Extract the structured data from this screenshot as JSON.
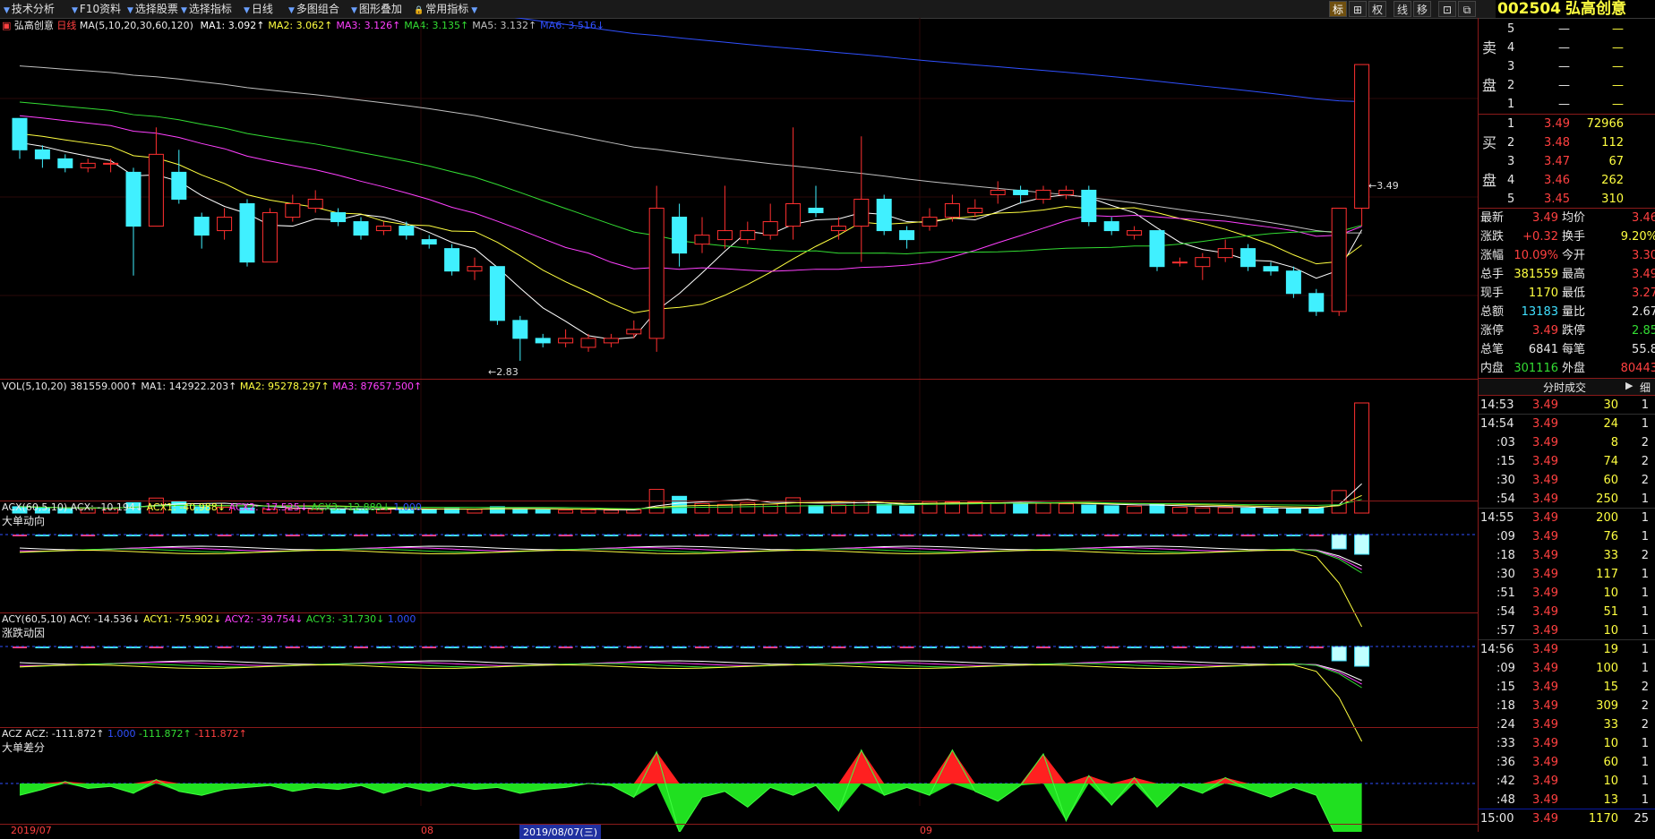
{
  "toolbar": {
    "items": [
      "技术分析",
      "F10资料",
      "选择股票",
      "选择指标",
      "日线",
      "多图组合",
      "图形叠加",
      "常用指标"
    ],
    "icons": [
      "标",
      "⊞",
      "权",
      "线",
      "移",
      "⊡",
      "⧉"
    ]
  },
  "stock": {
    "code": "002504",
    "name": "弘高创意"
  },
  "chart": {
    "title": "弘高创意",
    "period": "日线",
    "ma_label": "MA(5,10,20,30,60,120)",
    "ma": [
      {
        "name": "MA1:",
        "value": "3.092↑",
        "color": "#ffffff"
      },
      {
        "name": "MA2:",
        "value": "3.062↑",
        "color": "#ffff40"
      },
      {
        "name": "MA3:",
        "value": "3.126↑",
        "color": "#ff40ff"
      },
      {
        "name": "MA4:",
        "value": "3.135↑",
        "color": "#33dd33"
      },
      {
        "name": "MA5:",
        "value": "3.132↑",
        "color": "#c0c0c0"
      },
      {
        "name": "MA6:",
        "value": "3.516↓",
        "color": "#3050ff"
      }
    ],
    "high_mark": "3.49",
    "low_mark": "2.83",
    "vol": {
      "label": "VOL(5,10,20)",
      "value": "381559.000↑",
      "ma1": "MA1: 142922.203↑",
      "ma2": "MA2: 95278.297↑",
      "ma3": "MA3: 87657.500↑"
    },
    "acx": {
      "label": "ACX(60,5,10)",
      "acx": "ACX: -10.194↓",
      "acx1": "ACX1: -40.988↓",
      "acx2": "ACX2: -17.525↓",
      "acx3": "ACX3: -12.889↓",
      "c": "1.000",
      "sub": "大单动向"
    },
    "acy": {
      "label": "ACY(60,5,10)",
      "acy": "ACY: -14.536↓",
      "acy1": "ACY1: -75.902↓",
      "acy2": "ACY2: -39.754↓",
      "acy3": "ACY3: -31.730↓",
      "c": "1.000",
      "sub": "涨跌动因"
    },
    "acz": {
      "label": "ACZ",
      "acz": "ACZ: -111.872↑",
      "c": "1.000",
      "v2": "-111.872↑",
      "v3": "-111.872↑",
      "sub": "大单差分"
    },
    "dates": [
      "2019/07",
      "08",
      "2019/08/07(三)",
      "09"
    ]
  },
  "chart_data": {
    "type": "candlestick",
    "candles": [
      {
        "o": 3.37,
        "c": 3.3,
        "h": 3.37,
        "l": 3.28
      },
      {
        "o": 3.3,
        "c": 3.28,
        "h": 3.31,
        "l": 3.26
      },
      {
        "o": 3.28,
        "c": 3.26,
        "h": 3.29,
        "l": 3.25
      },
      {
        "o": 3.26,
        "c": 3.27,
        "h": 3.28,
        "l": 3.25
      },
      {
        "o": 3.27,
        "c": 3.27,
        "h": 3.28,
        "l": 3.25
      },
      {
        "o": 3.25,
        "c": 3.13,
        "h": 3.26,
        "l": 3.02
      },
      {
        "o": 3.13,
        "c": 3.29,
        "h": 3.35,
        "l": 3.13
      },
      {
        "o": 3.25,
        "c": 3.19,
        "h": 3.3,
        "l": 3.18
      },
      {
        "o": 3.15,
        "c": 3.11,
        "h": 3.16,
        "l": 3.08
      },
      {
        "o": 3.12,
        "c": 3.15,
        "h": 3.17,
        "l": 3.1
      },
      {
        "o": 3.18,
        "c": 3.05,
        "h": 3.19,
        "l": 3.04
      },
      {
        "o": 3.05,
        "c": 3.16,
        "h": 3.17,
        "l": 3.05
      },
      {
        "o": 3.15,
        "c": 3.18,
        "h": 3.2,
        "l": 3.14
      },
      {
        "o": 3.17,
        "c": 3.19,
        "h": 3.21,
        "l": 3.16
      },
      {
        "o": 3.16,
        "c": 3.14,
        "h": 3.17,
        "l": 3.13
      },
      {
        "o": 3.14,
        "c": 3.11,
        "h": 3.15,
        "l": 3.1
      },
      {
        "o": 3.12,
        "c": 3.13,
        "h": 3.14,
        "l": 3.11
      },
      {
        "o": 3.13,
        "c": 3.11,
        "h": 3.14,
        "l": 3.1
      },
      {
        "o": 3.1,
        "c": 3.09,
        "h": 3.11,
        "l": 3.08
      },
      {
        "o": 3.08,
        "c": 3.03,
        "h": 3.09,
        "l": 3.02
      },
      {
        "o": 3.03,
        "c": 3.04,
        "h": 3.06,
        "l": 3.01
      },
      {
        "o": 3.04,
        "c": 2.92,
        "h": 3.04,
        "l": 2.91
      },
      {
        "o": 2.92,
        "c": 2.88,
        "h": 2.93,
        "l": 2.83
      },
      {
        "o": 2.88,
        "c": 2.87,
        "h": 2.89,
        "l": 2.86
      },
      {
        "o": 2.87,
        "c": 2.88,
        "h": 2.9,
        "l": 2.86
      },
      {
        "o": 2.86,
        "c": 2.88,
        "h": 2.89,
        "l": 2.85
      },
      {
        "o": 2.87,
        "c": 2.88,
        "h": 2.89,
        "l": 2.86
      },
      {
        "o": 2.89,
        "c": 2.9,
        "h": 2.92,
        "l": 2.88
      },
      {
        "o": 2.88,
        "c": 3.17,
        "h": 3.22,
        "l": 2.85
      },
      {
        "o": 3.15,
        "c": 3.07,
        "h": 3.18,
        "l": 3.04
      },
      {
        "o": 3.09,
        "c": 3.11,
        "h": 3.15,
        "l": 3.07
      },
      {
        "o": 3.1,
        "c": 3.12,
        "h": 3.22,
        "l": 3.08
      },
      {
        "o": 3.1,
        "c": 3.12,
        "h": 3.14,
        "l": 3.09
      },
      {
        "o": 3.11,
        "c": 3.14,
        "h": 3.18,
        "l": 3.1
      },
      {
        "o": 3.13,
        "c": 3.18,
        "h": 3.35,
        "l": 3.1
      },
      {
        "o": 3.17,
        "c": 3.16,
        "h": 3.22,
        "l": 3.15
      },
      {
        "o": 3.12,
        "c": 3.13,
        "h": 3.15,
        "l": 3.1
      },
      {
        "o": 3.13,
        "c": 3.19,
        "h": 3.33,
        "l": 3.05
      },
      {
        "o": 3.19,
        "c": 3.12,
        "h": 3.2,
        "l": 3.11
      },
      {
        "o": 3.12,
        "c": 3.1,
        "h": 3.13,
        "l": 3.08
      },
      {
        "o": 3.13,
        "c": 3.15,
        "h": 3.17,
        "l": 3.12
      },
      {
        "o": 3.15,
        "c": 3.18,
        "h": 3.2,
        "l": 3.14
      },
      {
        "o": 3.16,
        "c": 3.17,
        "h": 3.19,
        "l": 3.15
      },
      {
        "o": 3.2,
        "c": 3.21,
        "h": 3.23,
        "l": 3.18
      },
      {
        "o": 3.21,
        "c": 3.2,
        "h": 3.22,
        "l": 3.18
      },
      {
        "o": 3.19,
        "c": 3.21,
        "h": 3.22,
        "l": 3.18
      },
      {
        "o": 3.2,
        "c": 3.21,
        "h": 3.22,
        "l": 3.19
      },
      {
        "o": 3.21,
        "c": 3.14,
        "h": 3.22,
        "l": 3.13
      },
      {
        "o": 3.14,
        "c": 3.12,
        "h": 3.15,
        "l": 3.11
      },
      {
        "o": 3.11,
        "c": 3.12,
        "h": 3.13,
        "l": 3.1
      },
      {
        "o": 3.12,
        "c": 3.04,
        "h": 3.12,
        "l": 3.03
      },
      {
        "o": 3.05,
        "c": 3.05,
        "h": 3.06,
        "l": 3.04
      },
      {
        "o": 3.04,
        "c": 3.06,
        "h": 3.07,
        "l": 3.01
      },
      {
        "o": 3.06,
        "c": 3.08,
        "h": 3.1,
        "l": 3.05
      },
      {
        "o": 3.08,
        "c": 3.04,
        "h": 3.09,
        "l": 3.03
      },
      {
        "o": 3.04,
        "c": 3.03,
        "h": 3.05,
        "l": 3.02
      },
      {
        "o": 3.03,
        "c": 2.98,
        "h": 3.04,
        "l": 2.97
      },
      {
        "o": 2.98,
        "c": 2.94,
        "h": 2.99,
        "l": 2.93
      },
      {
        "o": 2.94,
        "c": 3.17,
        "h": 3.17,
        "l": 2.93
      },
      {
        "o": 3.17,
        "c": 3.49,
        "h": 3.49,
        "l": 3.13
      }
    ],
    "volume": [
      22000,
      18000,
      15000,
      16000,
      15000,
      36000,
      52000,
      40000,
      22000,
      20000,
      18000,
      14000,
      16000,
      13000,
      14000,
      15000,
      12000,
      13000,
      14000,
      16000,
      13000,
      22000,
      15000,
      12000,
      10000,
      11000,
      10000,
      11000,
      82000,
      58000,
      33000,
      30000,
      35000,
      31000,
      53000,
      26000,
      28000,
      42000,
      30000,
      24000,
      40000,
      39000,
      38000,
      36000,
      35000,
      34000,
      32000,
      28000,
      25000,
      24000,
      30000,
      20000,
      18000,
      19000,
      17000,
      16000,
      15000,
      17000,
      78000,
      381559
    ],
    "ma_lines": [
      "MA1",
      "MA2",
      "MA3",
      "MA4",
      "MA5",
      "MA6"
    ],
    "ylim": [
      2.8,
      3.55
    ]
  },
  "quotes": {
    "sell_label": [
      "卖",
      "盘"
    ],
    "buy_label": [
      "买",
      "盘"
    ],
    "sell": [
      {
        "lvl": "5",
        "price": "—",
        "vol": "—"
      },
      {
        "lvl": "4",
        "price": "—",
        "vol": "—"
      },
      {
        "lvl": "3",
        "price": "—",
        "vol": "—"
      },
      {
        "lvl": "2",
        "price": "—",
        "vol": "—"
      },
      {
        "lvl": "1",
        "price": "—",
        "vol": "—"
      }
    ],
    "buy": [
      {
        "lvl": "1",
        "price": "3.49",
        "vol": "72966"
      },
      {
        "lvl": "2",
        "price": "3.48",
        "vol": "112"
      },
      {
        "lvl": "3",
        "price": "3.47",
        "vol": "67"
      },
      {
        "lvl": "4",
        "price": "3.46",
        "vol": "262"
      },
      {
        "lvl": "5",
        "price": "3.45",
        "vol": "310"
      }
    ],
    "stats": [
      {
        "k1": "最新",
        "v1": "3.49",
        "c1": "#ff4040",
        "k2": "均价",
        "v2": "3.46",
        "c2": "#ff4040"
      },
      {
        "k1": "涨跌",
        "v1": "+0.32",
        "c1": "#ff4040",
        "k2": "换手",
        "v2": "9.20%",
        "c2": "#ffff40"
      },
      {
        "k1": "涨幅",
        "v1": "10.09%",
        "c1": "#ff4040",
        "k2": "今开",
        "v2": "3.30",
        "c2": "#ff4040"
      },
      {
        "k1": "总手",
        "v1": "381559",
        "c1": "#ffff40",
        "k2": "最高",
        "v2": "3.49",
        "c2": "#ff4040"
      },
      {
        "k1": "现手",
        "v1": "1170",
        "c1": "#ffff40",
        "k2": "最低",
        "v2": "3.27",
        "c2": "#ff4040"
      },
      {
        "k1": "总额",
        "v1": "13183",
        "c1": "#40e0ff",
        "k2": "量比",
        "v2": "2.67",
        "c2": "#e8e8e8"
      },
      {
        "k1": "涨停",
        "v1": "3.49",
        "c1": "#ff4040",
        "k2": "跌停",
        "v2": "2.85",
        "c2": "#33dd33"
      },
      {
        "k1": "总笔",
        "v1": "6841",
        "c1": "#e8e8e8",
        "k2": "每笔",
        "v2": "55.8",
        "c2": "#e8e8e8"
      },
      {
        "k1": "内盘",
        "v1": "301116",
        "c1": "#33dd33",
        "k2": "外盘",
        "v2": "80443",
        "c2": "#ff4040"
      }
    ],
    "ticks_title": "分时成交",
    "ticks_btn": "细",
    "ticks": [
      {
        "t": "14:53",
        "p": "3.49",
        "v": "30",
        "n": "1",
        "big": true
      },
      {
        "t": "14:54",
        "p": "3.49",
        "v": "24",
        "n": "1",
        "big": true
      },
      {
        "t": ":03",
        "p": "3.49",
        "v": "8",
        "n": "2",
        "big": false
      },
      {
        "t": ":15",
        "p": "3.49",
        "v": "74",
        "n": "2",
        "big": false
      },
      {
        "t": ":30",
        "p": "3.49",
        "v": "60",
        "n": "2",
        "big": false
      },
      {
        "t": ":54",
        "p": "3.49",
        "v": "250",
        "n": "1",
        "big": false
      },
      {
        "t": "14:55",
        "p": "3.49",
        "v": "200",
        "n": "1",
        "big": true
      },
      {
        "t": ":09",
        "p": "3.49",
        "v": "76",
        "n": "1",
        "big": false
      },
      {
        "t": ":18",
        "p": "3.49",
        "v": "33",
        "n": "2",
        "big": false
      },
      {
        "t": ":30",
        "p": "3.49",
        "v": "117",
        "n": "1",
        "big": false
      },
      {
        "t": ":51",
        "p": "3.49",
        "v": "10",
        "n": "1",
        "big": false
      },
      {
        "t": ":54",
        "p": "3.49",
        "v": "51",
        "n": "1",
        "big": false
      },
      {
        "t": ":57",
        "p": "3.49",
        "v": "10",
        "n": "1",
        "big": false
      },
      {
        "t": "14:56",
        "p": "3.49",
        "v": "19",
        "n": "1",
        "big": true
      },
      {
        "t": ":09",
        "p": "3.49",
        "v": "100",
        "n": "1",
        "big": false
      },
      {
        "t": ":15",
        "p": "3.49",
        "v": "15",
        "n": "2",
        "big": false
      },
      {
        "t": ":18",
        "p": "3.49",
        "v": "309",
        "n": "2",
        "big": false
      },
      {
        "t": ":24",
        "p": "3.49",
        "v": "33",
        "n": "2",
        "big": false
      },
      {
        "t": ":33",
        "p": "3.49",
        "v": "10",
        "n": "1",
        "big": false
      },
      {
        "t": ":36",
        "p": "3.49",
        "v": "60",
        "n": "1",
        "big": false
      },
      {
        "t": ":42",
        "p": "3.49",
        "v": "10",
        "n": "1",
        "big": false
      },
      {
        "t": ":48",
        "p": "3.49",
        "v": "13",
        "n": "1",
        "big": false
      },
      {
        "t": "15:00",
        "p": "3.49",
        "v": "1170",
        "n": "25",
        "big": true
      }
    ]
  }
}
